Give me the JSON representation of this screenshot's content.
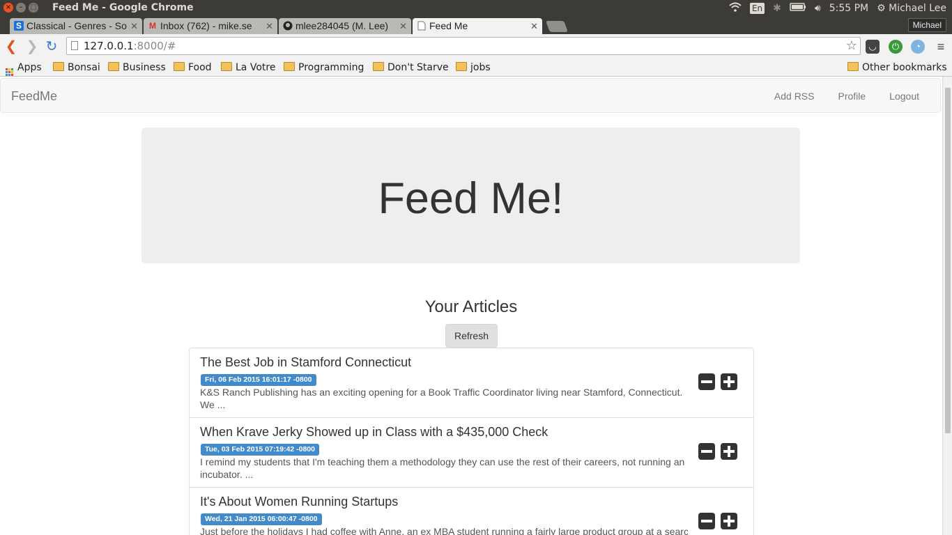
{
  "os": {
    "window_title": "Feed Me - Google Chrome",
    "lang": "En",
    "time": "5:55 PM",
    "user": "Michael Lee"
  },
  "tabs": [
    {
      "label": "Classical - Genres - So",
      "favicon": "S"
    },
    {
      "label": "Inbox (762) - mike.se",
      "favicon": "M"
    },
    {
      "label": "mlee284045 (M. Lee)",
      "favicon": "gh"
    },
    {
      "label": "Feed Me",
      "favicon": "doc"
    }
  ],
  "profile_name": "Michael",
  "omnibox": {
    "host": "127.0.0.1",
    "rest": ":8000/#"
  },
  "bookmarks": {
    "apps": "Apps",
    "items": [
      "Bonsai",
      "Business",
      "Food",
      "La Votre",
      "Programming",
      "Don't Starve",
      "jobs"
    ],
    "other": "Other bookmarks"
  },
  "app": {
    "brand": "FeedMe",
    "nav": [
      "Add RSS",
      "Profile",
      "Logout"
    ],
    "hero_title": "Feed Me!",
    "section_title": "Your Articles",
    "refresh_label": "Refresh"
  },
  "articles": [
    {
      "title": "The Best Job in Stamford Connecticut",
      "date": "Fri, 06 Feb 2015 16:01:17 -0800",
      "desc": "K&S Ranch Publishing has an exciting opening for a Book Traffic Coordinator living near Stamford, Connecticut. We ..."
    },
    {
      "title": "When Krave Jerky Showed up in Class with a $435,000 Check",
      "date": "Tue, 03 Feb 2015 07:19:42 -0800",
      "desc": "I remind my students that I'm teaching them a methodology they can use the rest of their careers, not running an incubator. ..."
    },
    {
      "title": "It's About Women Running Startups",
      "date": "Wed, 21 Jan 2015 06:00:47 -0800",
      "desc": "Just before the holidays I had coffee with Anne, an ex MBA student running a fairly large product group at a search"
    }
  ],
  "colors": {
    "ubuntu_panel": "#3c3b37",
    "label_primary": "#428bca",
    "jumbotron": "#eeeeee"
  }
}
